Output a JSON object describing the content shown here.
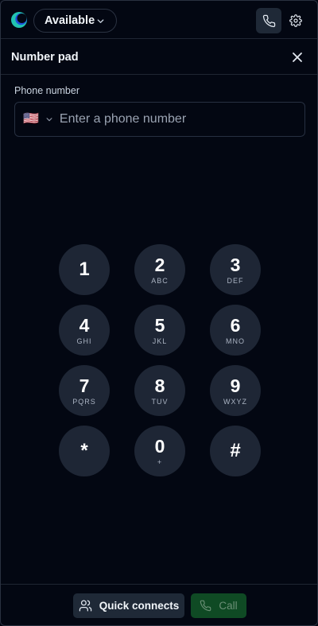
{
  "topbar": {
    "status_label": "Available",
    "icons": {
      "logo": "app-logo",
      "status_chevron": "chevron-down-icon",
      "phone": "phone-icon",
      "settings": "gear-icon"
    }
  },
  "panel": {
    "title": "Number pad",
    "close_icon": "close-icon"
  },
  "phone_field": {
    "label": "Phone number",
    "flag": "🇺🇸",
    "placeholder": "Enter a phone number",
    "value": ""
  },
  "keypad": {
    "keys": [
      {
        "digit": "1",
        "letters": ""
      },
      {
        "digit": "2",
        "letters": "ABC"
      },
      {
        "digit": "3",
        "letters": "DEF"
      },
      {
        "digit": "4",
        "letters": "GHI"
      },
      {
        "digit": "5",
        "letters": "JKL"
      },
      {
        "digit": "6",
        "letters": "MNO"
      },
      {
        "digit": "7",
        "letters": "PQRS"
      },
      {
        "digit": "8",
        "letters": "TUV"
      },
      {
        "digit": "9",
        "letters": "WXYZ"
      },
      {
        "digit": "*",
        "letters": ""
      },
      {
        "digit": "0",
        "letters": "+"
      },
      {
        "digit": "#",
        "letters": ""
      }
    ]
  },
  "footer": {
    "quick_connects_label": "Quick connects",
    "call_label": "Call"
  },
  "colors": {
    "background": "#030712",
    "key_background": "#1e2635",
    "call_button": "#0f4a24",
    "accent_teal": "#22c3b0"
  }
}
